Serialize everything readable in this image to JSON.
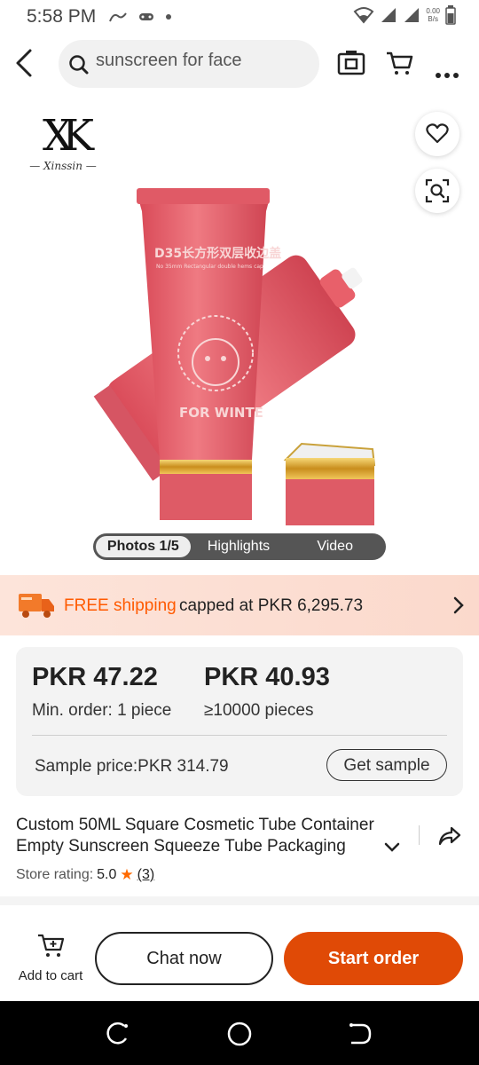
{
  "status_bar": {
    "time": "5:58 PM",
    "net_speed_value": "0.00",
    "net_speed_unit": "B/s"
  },
  "header": {
    "search_text": "sunscreen for face",
    "icons": [
      "back-arrow-icon",
      "search-icon",
      "camera-icon",
      "cart-icon",
      "more-icon"
    ]
  },
  "gallery": {
    "brand_mark": "XK",
    "brand_name": "— Xinssin —",
    "tube_print_title": "D35长方形双层收边盖",
    "tube_print_subtitle": "No 35mm Rectangular double hems cap",
    "tube_print_caption": "FOR WINTE",
    "tabs": [
      {
        "label": "Photos 1/5",
        "active": true
      },
      {
        "label": "Highlights",
        "active": false
      },
      {
        "label": "Video",
        "active": false
      }
    ]
  },
  "shipping": {
    "free_label": "FREE shipping",
    "rest_label": "capped at PKR 6,295.73"
  },
  "pricing": {
    "tier1_price": "PKR 47.22",
    "tier1_moq": "Min. order: 1 piece",
    "tier2_price": "PKR 40.93",
    "tier2_moq": "≥10000 pieces",
    "sample_price": "Sample price:PKR 314.79",
    "sample_button": "Get sample"
  },
  "product": {
    "title": "Custom 50ML Square Cosmetic Tube Container Empty Sunscreen Squeeze Tube Packaging",
    "rating_label": "Store rating:",
    "rating_value": "5.0",
    "rating_count": "(3)"
  },
  "actions": {
    "add_to_cart": "Add to cart",
    "chat_now": "Chat now",
    "start_order": "Start order"
  },
  "colors": {
    "accent_orange": "#ff5a00",
    "order_button": "#e04a06",
    "tube_pink": "#e8606a",
    "gold_cap": "#d9a52c"
  }
}
